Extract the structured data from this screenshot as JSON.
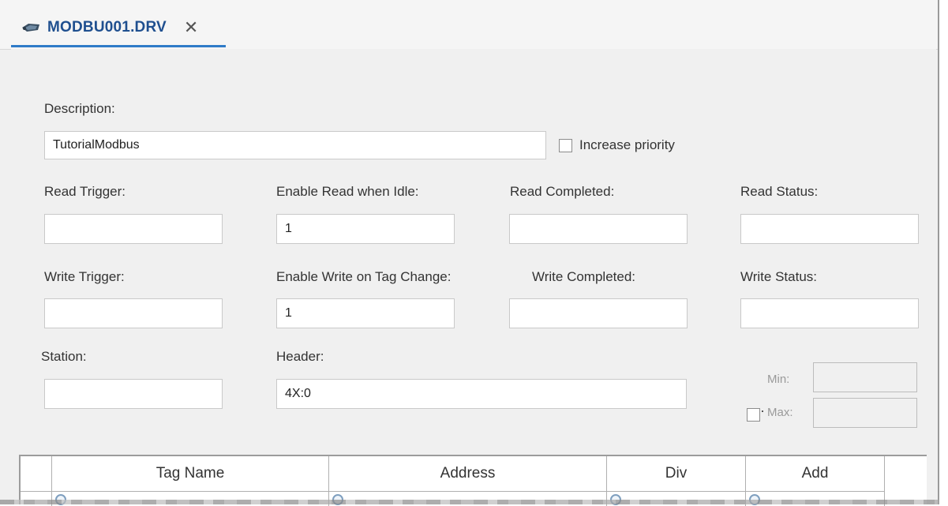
{
  "tab": {
    "icon": "driver-icon",
    "title": "MODBU001.DRV",
    "close_label": "✕"
  },
  "form": {
    "description_label": "Description:",
    "description_value": "TutorialModbus",
    "increase_priority_label": "Increase priority",
    "increase_priority_checked": false,
    "read_trigger_label": "Read Trigger:",
    "read_trigger_value": "",
    "enable_read_idle_label": "Enable Read when Idle:",
    "enable_read_idle_value": "1",
    "read_completed_label": "Read Completed:",
    "read_completed_value": "",
    "read_status_label": "Read Status:",
    "read_status_value": "",
    "write_trigger_label": "Write Trigger:",
    "write_trigger_value": "",
    "enable_write_change_label": "Enable Write on Tag Change:",
    "enable_write_change_value": "1",
    "write_completed_label": "Write Completed:",
    "write_completed_value": "",
    "write_status_label": "Write Status:",
    "write_status_value": "",
    "station_label": "Station:",
    "station_value": "",
    "header_label": "Header:",
    "header_value": "4X:0",
    "min_label": "Min:",
    "max_label": "Max:",
    "min_value": "",
    "max_value": "",
    "scaling_checked": false
  },
  "grid": {
    "columns": [
      "Tag Name",
      "Address",
      "Div",
      "Add"
    ]
  },
  "colors": {
    "tab_accent": "#2f7bc8",
    "tab_title": "#1f4f8f",
    "panel_bg": "#f0f0f0"
  }
}
